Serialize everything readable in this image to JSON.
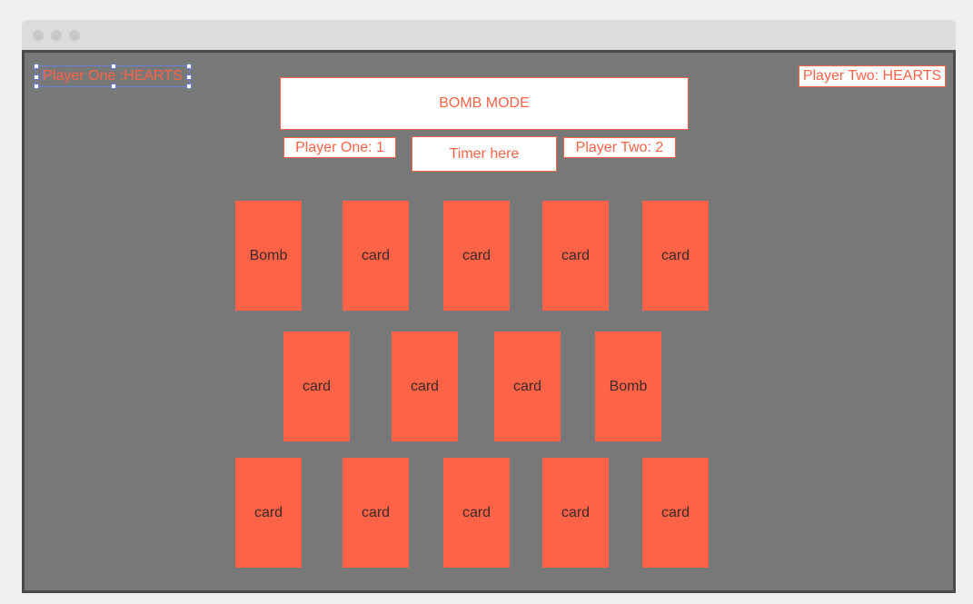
{
  "window": {
    "controls": [
      "close-dot",
      "minimize-dot",
      "maximize-dot"
    ]
  },
  "header": {
    "player_one_hearts": "Player One :HEARTS",
    "player_two_hearts": "Player Two: HEARTS",
    "mode_title": "BOMB MODE",
    "player_one_score": "Player One: 1",
    "timer": "Timer here",
    "player_two_score": "Player Two: 2"
  },
  "cards": {
    "row1": [
      "Bomb",
      "card",
      "card",
      "card",
      "card"
    ],
    "row2": [
      "card",
      "card",
      "card",
      "Bomb"
    ],
    "row3": [
      "card",
      "card",
      "card",
      "card",
      "card"
    ]
  },
  "colors": {
    "card": "#ff6347",
    "canvas": "#787878",
    "accent_text": "#ff6347",
    "selection": "#6a80d8"
  }
}
